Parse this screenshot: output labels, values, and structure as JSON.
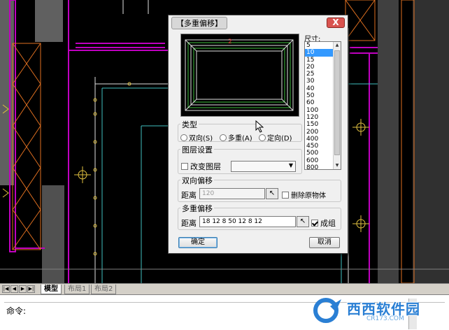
{
  "dialog": {
    "title": "【多重偏移】",
    "close_label": "X",
    "preview_marker": "2",
    "size": {
      "label": "尺寸:",
      "options": [
        "5",
        "10",
        "15",
        "20",
        "25",
        "30",
        "40",
        "50",
        "60",
        "100",
        "120",
        "150",
        "200",
        "400",
        "450",
        "500",
        "600",
        "800"
      ],
      "selected": "10"
    },
    "type_group": {
      "label": "类型",
      "options": [
        "双向(S)",
        "多重(A)",
        "定向(D)"
      ]
    },
    "layer_group": {
      "label": "图层设置",
      "change_layer_label": "改变图层",
      "layer_select_value": ""
    },
    "bidirectional_group": {
      "label": "双向偏移",
      "distance_label": "距离",
      "distance_value": "120",
      "delete_source_label": "删除原物体"
    },
    "multiple_group": {
      "label": "多重偏移",
      "distance_label": "距离",
      "distance_value": "18 12 8 50 12 8 12",
      "make_group_label": "成组",
      "make_group_checked": true
    },
    "ok_label": "确定",
    "cancel_label": "取消"
  },
  "layout_tabs": {
    "model": "模型",
    "layout1": "布局1",
    "layout2": "布局2"
  },
  "command": {
    "prompt": "命令:"
  },
  "watermark": {
    "text": "西西软件园",
    "sub": "CR173.COM"
  },
  "colors": {
    "cad_background": "#000000",
    "magenta_line": "#c000c0",
    "orange_line": "#e07020",
    "white_line": "#e0e0e0",
    "cyan_line": "#40c0c0",
    "yellow_line": "#e0c040",
    "selection_blue": "#3399ff"
  }
}
